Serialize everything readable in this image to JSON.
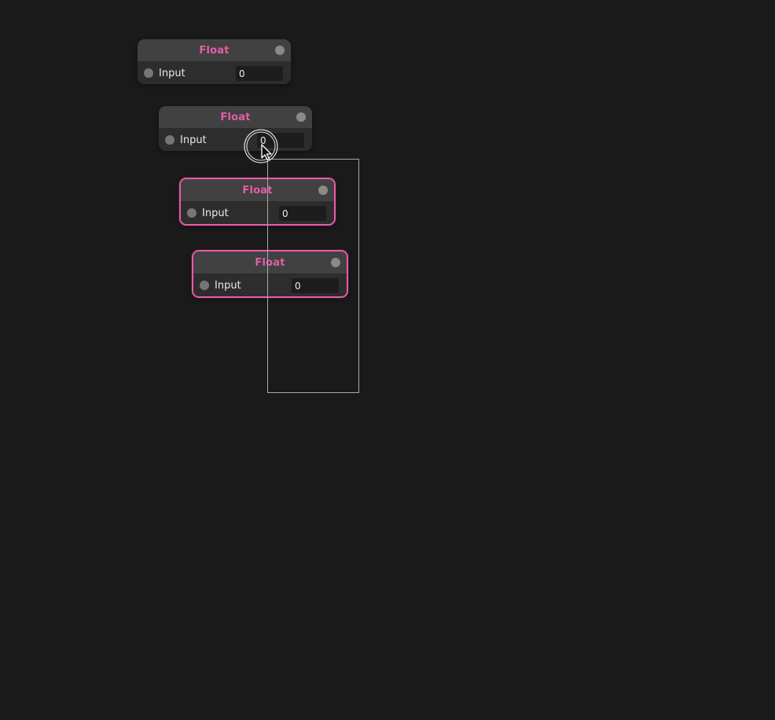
{
  "canvas": {
    "background": "#1a1a1a",
    "accent": "#e35da9",
    "selection_border": "#a9a9a9"
  },
  "nodes": [
    {
      "title": "Float",
      "input_label": "Input",
      "input_value": "0",
      "selected": false
    },
    {
      "title": "Float",
      "input_label": "Input",
      "input_value": "0",
      "selected": false
    },
    {
      "title": "Float",
      "input_label": "Input",
      "input_value": "0",
      "selected": true
    },
    {
      "title": "Float",
      "input_label": "Input",
      "input_value": "0",
      "selected": true
    }
  ],
  "cursor": {
    "icon": "arrow-cursor-icon",
    "click_indicator": "click-ring-icon"
  }
}
